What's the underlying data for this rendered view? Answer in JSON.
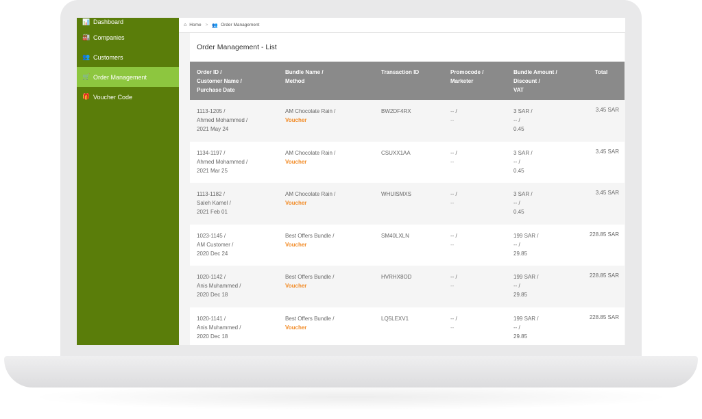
{
  "sidebar": {
    "items": [
      {
        "label": "Dashboard",
        "icon": "bar-chart-icon",
        "glyph": "📊"
      },
      {
        "label": "Companies",
        "icon": "industry-icon",
        "glyph": "🏭"
      },
      {
        "label": "Customers",
        "icon": "users-icon",
        "glyph": "👥"
      },
      {
        "label": "Order Management",
        "icon": "cart-icon",
        "glyph": "🛒",
        "active": true
      },
      {
        "label": "Voucher Code",
        "icon": "gift-icon",
        "glyph": "🎁"
      }
    ]
  },
  "breadcrumb": {
    "home": "Home",
    "separator": ">",
    "current": "Order Management"
  },
  "panel": {
    "title": "Order Management - List"
  },
  "table": {
    "headers": {
      "order": [
        "Order ID /",
        "Customer Name /",
        "Purchase Date"
      ],
      "bundle": [
        "Bundle Name /",
        "Method"
      ],
      "transaction": [
        "Transaction ID"
      ],
      "promo": [
        "Promocode /",
        "Marketer"
      ],
      "amount": [
        "Bundle Amount /",
        "Discount /",
        "VAT"
      ],
      "total": [
        "Total"
      ]
    },
    "rows": [
      {
        "order_id": "1113-1205 /",
        "customer": "Ahmed Mohammed /",
        "date": "2021 May 24",
        "bundle": "AM Chocolate Rain /",
        "method": "Voucher",
        "transaction": "BW2DF4RX",
        "promo": "-- /",
        "marketer": "--",
        "amount": "3 SAR /",
        "discount": "-- /",
        "vat": "0.45",
        "total": "3.45 SAR"
      },
      {
        "order_id": "1134-1197 /",
        "customer": "Ahmed Mohammed /",
        "date": "2021 Mar 25",
        "bundle": "AM Chocolate Rain /",
        "method": "Voucher",
        "transaction": "CSUXX1AA",
        "promo": "-- /",
        "marketer": "--",
        "amount": "3 SAR /",
        "discount": "-- /",
        "vat": "0.45",
        "total": "3.45 SAR"
      },
      {
        "order_id": "1113-1182 /",
        "customer": "Saleh Kamel /",
        "date": "2021 Feb 01",
        "bundle": "AM Chocolate Rain /",
        "method": "Voucher",
        "transaction": "WHUISMXS",
        "promo": "-- /",
        "marketer": "--",
        "amount": "3 SAR /",
        "discount": "-- /",
        "vat": "0.45",
        "total": "3.45 SAR"
      },
      {
        "order_id": "1023-1145 /",
        "customer": "AM Customer /",
        "date": "2020 Dec 24",
        "bundle": "Best Offers Bundle /",
        "method": "Voucher",
        "transaction": "SM40LXLN",
        "promo": "-- /",
        "marketer": "--",
        "amount": "199 SAR /",
        "discount": "-- /",
        "vat": "29.85",
        "total": "228.85 SAR"
      },
      {
        "order_id": "1020-1142 /",
        "customer": "Anis Muhammed /",
        "date": "2020 Dec 18",
        "bundle": "Best Offers Bundle /",
        "method": "Voucher",
        "transaction": "HVRHX8OD",
        "promo": "-- /",
        "marketer": "--",
        "amount": "199 SAR /",
        "discount": "-- /",
        "vat": "29.85",
        "total": "228.85 SAR"
      },
      {
        "order_id": "1020-1141 /",
        "customer": "Anis Muhammed /",
        "date": "2020 Dec 18",
        "bundle": "Best Offers Bundle /",
        "method": "Voucher",
        "transaction": "LQ5LEXV1",
        "promo": "-- /",
        "marketer": "--",
        "amount": "199 SAR /",
        "discount": "-- /",
        "vat": "29.85",
        "total": "228.85 SAR"
      }
    ]
  },
  "colors": {
    "sidebar": "#5a7d0a",
    "active": "#8dc63f",
    "header": "#8a8a8a",
    "method": "#f28c28"
  }
}
